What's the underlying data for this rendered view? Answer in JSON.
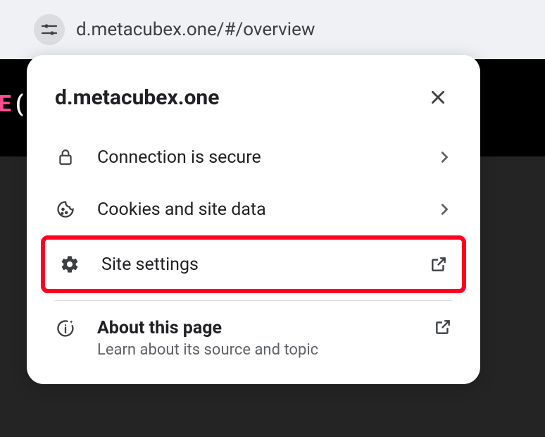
{
  "addressBar": {
    "url": "d.metacubex.one/#/overview"
  },
  "leftEdge": {
    "char": "E",
    "paren": "("
  },
  "popup": {
    "domain": "d.metacubex.one",
    "items": {
      "connection": {
        "label": "Connection is secure"
      },
      "cookies": {
        "label": "Cookies and site data"
      },
      "settings": {
        "label": "Site settings"
      }
    },
    "about": {
      "title": "About this page",
      "subtitle": "Learn about its source and topic"
    }
  }
}
